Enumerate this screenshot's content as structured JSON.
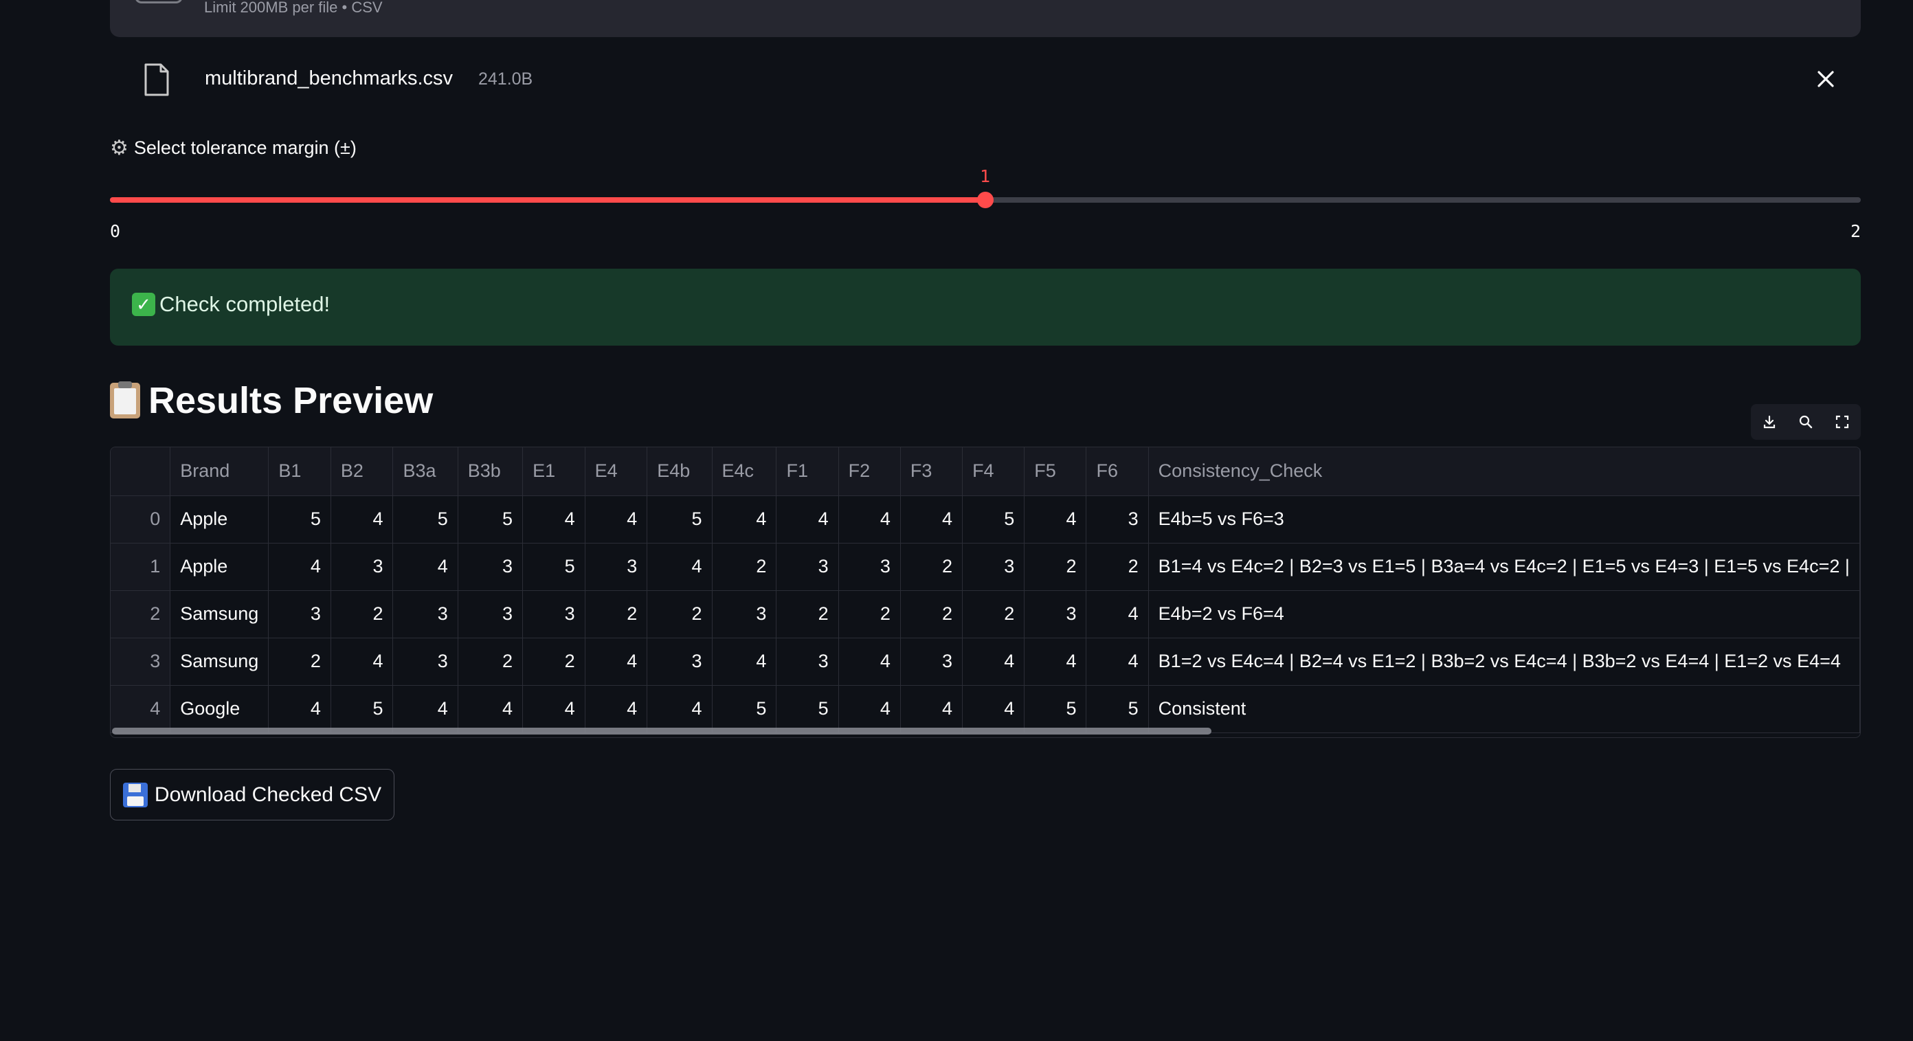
{
  "uploader": {
    "limit_text": "Limit 200MB per file • CSV",
    "file_name": "multibrand_benchmarks.csv",
    "file_size": "241.0B"
  },
  "slider": {
    "label": "Select tolerance margin (±)",
    "value": "1",
    "min": "0",
    "max": "2",
    "fraction": 0.5
  },
  "status": {
    "success_text": "Check completed!"
  },
  "results": {
    "heading": "Results Preview",
    "columns": [
      "",
      "Brand",
      "B1",
      "B2",
      "B3a",
      "B3b",
      "E1",
      "E4",
      "E4b",
      "E4c",
      "F1",
      "F2",
      "F3",
      "F4",
      "F5",
      "F6",
      "Consistency_Check"
    ],
    "rows": [
      [
        "0",
        "Apple",
        "5",
        "4",
        "5",
        "5",
        "4",
        "4",
        "5",
        "4",
        "4",
        "4",
        "4",
        "5",
        "4",
        "3",
        "E4b=5 vs F6=3"
      ],
      [
        "1",
        "Apple",
        "4",
        "3",
        "4",
        "3",
        "5",
        "3",
        "4",
        "2",
        "3",
        "3",
        "2",
        "3",
        "2",
        "2",
        "B1=4 vs E4c=2 | B2=3 vs E1=5 | B3a=4 vs E4c=2 | E1=5 vs E4=3 | E1=5 vs E4c=2 |"
      ],
      [
        "2",
        "Samsung",
        "3",
        "2",
        "3",
        "3",
        "3",
        "2",
        "2",
        "3",
        "2",
        "2",
        "2",
        "2",
        "3",
        "4",
        "E4b=2 vs F6=4"
      ],
      [
        "3",
        "Samsung",
        "2",
        "4",
        "3",
        "2",
        "2",
        "4",
        "3",
        "4",
        "3",
        "4",
        "3",
        "4",
        "4",
        "4",
        "B1=2 vs E4c=4 | B2=4 vs E1=2 | B3b=2 vs E4c=4 | B3b=2 vs E4=4 | E1=2 vs E4=4"
      ],
      [
        "4",
        "Google",
        "4",
        "5",
        "4",
        "4",
        "4",
        "4",
        "4",
        "5",
        "5",
        "4",
        "4",
        "4",
        "5",
        "5",
        "Consistent"
      ]
    ]
  },
  "download": {
    "label": "Download Checked CSV"
  }
}
